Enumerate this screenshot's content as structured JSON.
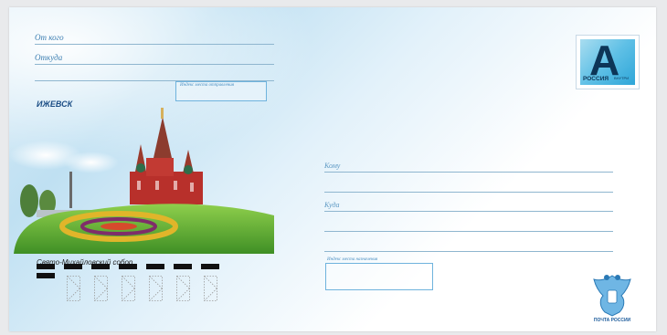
{
  "sender": {
    "from_label": "От кого",
    "where_label": "Откуда",
    "index_label": "Индекс места отправления"
  },
  "city": "ИЖЕВСК",
  "caption": "Свято-Михайловский собор",
  "stamp": {
    "letter": "А",
    "country": "РОССИЯ",
    "small_text": "ВНУТРИ"
  },
  "recipient": {
    "to_label": "Кому",
    "where_label": "Куда",
    "index_label": "Индекс места назначения"
  },
  "post_logo_text": "ПОЧТА РОССИИ",
  "colors": {
    "sky": "#bfe0f2",
    "line": "#8fb6cf",
    "accent_blue": "#2ea6d8",
    "grass": "#4fa22d",
    "church_red": "#b8302b"
  }
}
